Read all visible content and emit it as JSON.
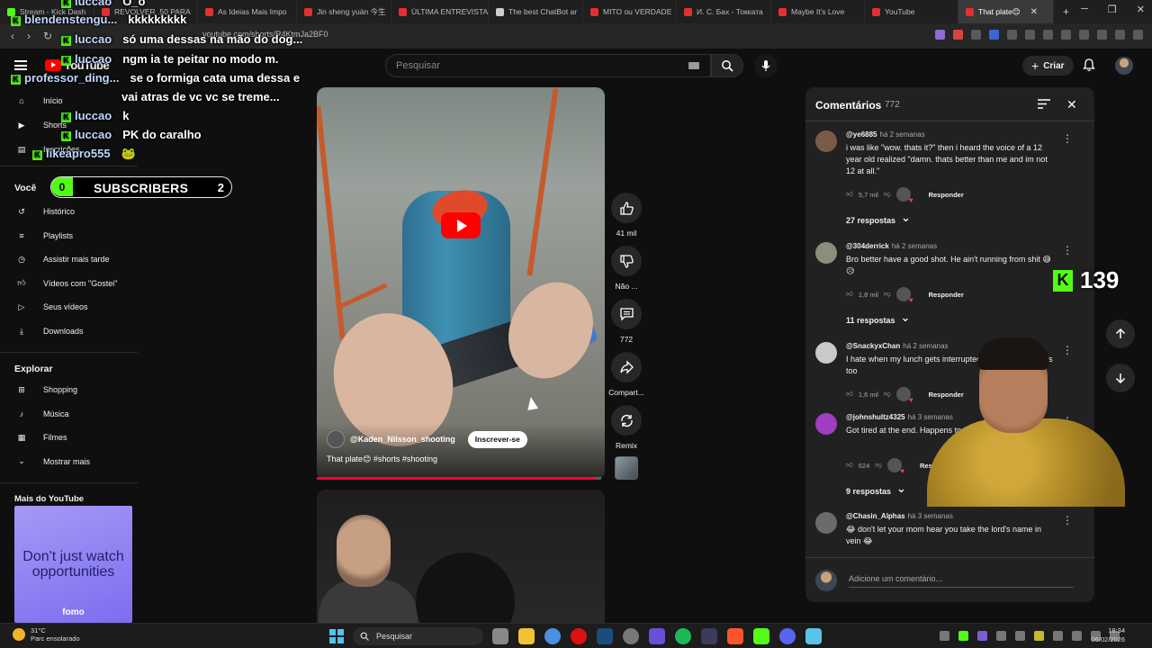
{
  "browser": {
    "tabs": [
      {
        "label": "Stream - Kick Dash",
        "fav_color": "#53fc18"
      },
      {
        "label": "REVOLVER .50 PARA",
        "fav_color": "#e3302f"
      },
      {
        "label": "As Ideias Mais Impo",
        "fav_color": "#e3302f"
      },
      {
        "label": "Jin sheng yuán 今生",
        "fav_color": "#e3302f"
      },
      {
        "label": "ÚLTIMA ENTREVISTA",
        "fav_color": "#e3302f"
      },
      {
        "label": "The best ChatBot ar",
        "fav_color": "#cccccc"
      },
      {
        "label": "MITO ou VERDADE",
        "fav_color": "#e3302f"
      },
      {
        "label": "И. С. Бах - Токката",
        "fav_color": "#e3302f"
      },
      {
        "label": "Maybe It's Love",
        "fav_color": "#e3302f"
      },
      {
        "label": "YouTube",
        "fav_color": "#e3302f"
      },
      {
        "label": "That plate😊",
        "fav_color": "#e3302f"
      }
    ],
    "new_tab": "+",
    "url": "youtube.com/shorts/R4KtmJa2BF0"
  },
  "header": {
    "logo": "YouTube",
    "search_placeholder": "Pesquisar",
    "create_label": "Criar"
  },
  "sidebar": {
    "top_items": [
      {
        "label": "Início",
        "icon": "home-icon"
      },
      {
        "label": "Shorts",
        "icon": "shorts-icon"
      },
      {
        "label": "Inscrições",
        "icon": "subscriptions-icon"
      }
    ],
    "you_label": "Você",
    "you_items": [
      {
        "label": "Histórico",
        "icon": "history-icon"
      },
      {
        "label": "Playlists",
        "icon": "playlists-icon"
      },
      {
        "label": "Assistir mais tarde",
        "icon": "watch-later-icon"
      },
      {
        "label": "Vídeos com \"Gostei\"",
        "icon": "like-icon"
      },
      {
        "label": "Seus vídeos",
        "icon": "your-videos-icon"
      },
      {
        "label": "Downloads",
        "icon": "download-icon"
      }
    ],
    "explore_label": "Explorar",
    "explore_items": [
      {
        "label": "Shopping",
        "icon": "shopping-icon"
      },
      {
        "label": "Música",
        "icon": "music-icon"
      },
      {
        "label": "Filmes",
        "icon": "movies-icon"
      },
      {
        "label": "Mostrar mais",
        "icon": "chevron-down-icon"
      }
    ],
    "more_label": "Mais do YouTube",
    "ad": {
      "text": "Don't just watch opportunities",
      "brand": "fomo"
    }
  },
  "chat": {
    "lines": [
      {
        "user": "luccao",
        "msg": "O_o"
      },
      {
        "user": "blendenstengu...",
        "msg": "kkkkkkkkk"
      },
      {
        "user": "luccao",
        "msg": "só uma dessas na mão do dog..."
      },
      {
        "user": "luccao",
        "msg": "ngm ia te peitar no modo m."
      },
      {
        "user": "professor_ding...",
        "msg": "se o formiga cata uma dessa e"
      },
      {
        "user": "",
        "msg": "vai atras de vc vc se treme..."
      },
      {
        "user": "luccao",
        "msg": "k"
      },
      {
        "user": "luccao",
        "msg": "PK do caralho"
      },
      {
        "user": "likeapro555",
        "msg": "🐸"
      }
    ],
    "subscribers": {
      "label": "SUBSCRIBERS",
      "current": "0",
      "goal": "2"
    }
  },
  "short": {
    "channel": "@Kaden_Nilsson_shooting",
    "subscribe_label": "Inscrever-se",
    "title": "That plate😊 #shorts #shooting",
    "progress": 0.98,
    "actions": [
      {
        "label": "41 mil",
        "icon": "like-icon"
      },
      {
        "label": "Não ...",
        "icon": "dislike-icon"
      },
      {
        "label": "772",
        "icon": "comment-icon"
      },
      {
        "label": "Compart...",
        "icon": "share-icon"
      },
      {
        "label": "Remix",
        "icon": "remix-icon"
      }
    ]
  },
  "comments": {
    "title": "Comentários",
    "count": "772",
    "items": [
      {
        "author": "@ye6885",
        "when": "há 2 semanas",
        "text": "i was like \"wow. thats it?\" then i heard the voice of a 12 year old realized \"damn. thats better than me and im not 12 at all.\"",
        "likes": "5,7 mil",
        "reply": "Responder",
        "replies": "27 respostas",
        "avatar_color": "#7a5a48"
      },
      {
        "author": "@304derrick",
        "when": "há 2 semanas",
        "text": "Bro better have a good shot. He ain't running from shit 😅😥",
        "likes": "1,8 mil",
        "reply": "Responder",
        "replies": "11 respostas",
        "avatar_color": "#8a8f7c"
      },
      {
        "author": "@SnackyxChan",
        "when": "há 2 semanas",
        "text": "I hate when my lunch gets interrupted by cardboard thugs too",
        "likes": "1,6 mil",
        "reply": "Responder",
        "replies": "",
        "avatar_color": "#c9c9c9"
      },
      {
        "author": "@johnshultz4325",
        "when": "há 3 semanas",
        "text": "Got tired at the end. Happens to all of us tho!",
        "likes": "624",
        "reply": "Responder",
        "replies": "9 respostas",
        "avatar_color": "#a03dc0"
      },
      {
        "author": "@Chasin_Alphas",
        "when": "há 3 semanas",
        "text": "😂 don't let your mom hear you take the lord's name in vein 😂",
        "likes": "",
        "reply": "",
        "replies": "",
        "avatar_color": "#6b6b6b"
      }
    ],
    "add_placeholder": "Adicione um comentário..."
  },
  "stream": {
    "kick_viewers": "139"
  },
  "taskbar": {
    "temp": "31°C",
    "weather": "Parc ensolarado",
    "search_label": "Pesquisar",
    "time": "18:34",
    "date": "06/02/2026"
  }
}
